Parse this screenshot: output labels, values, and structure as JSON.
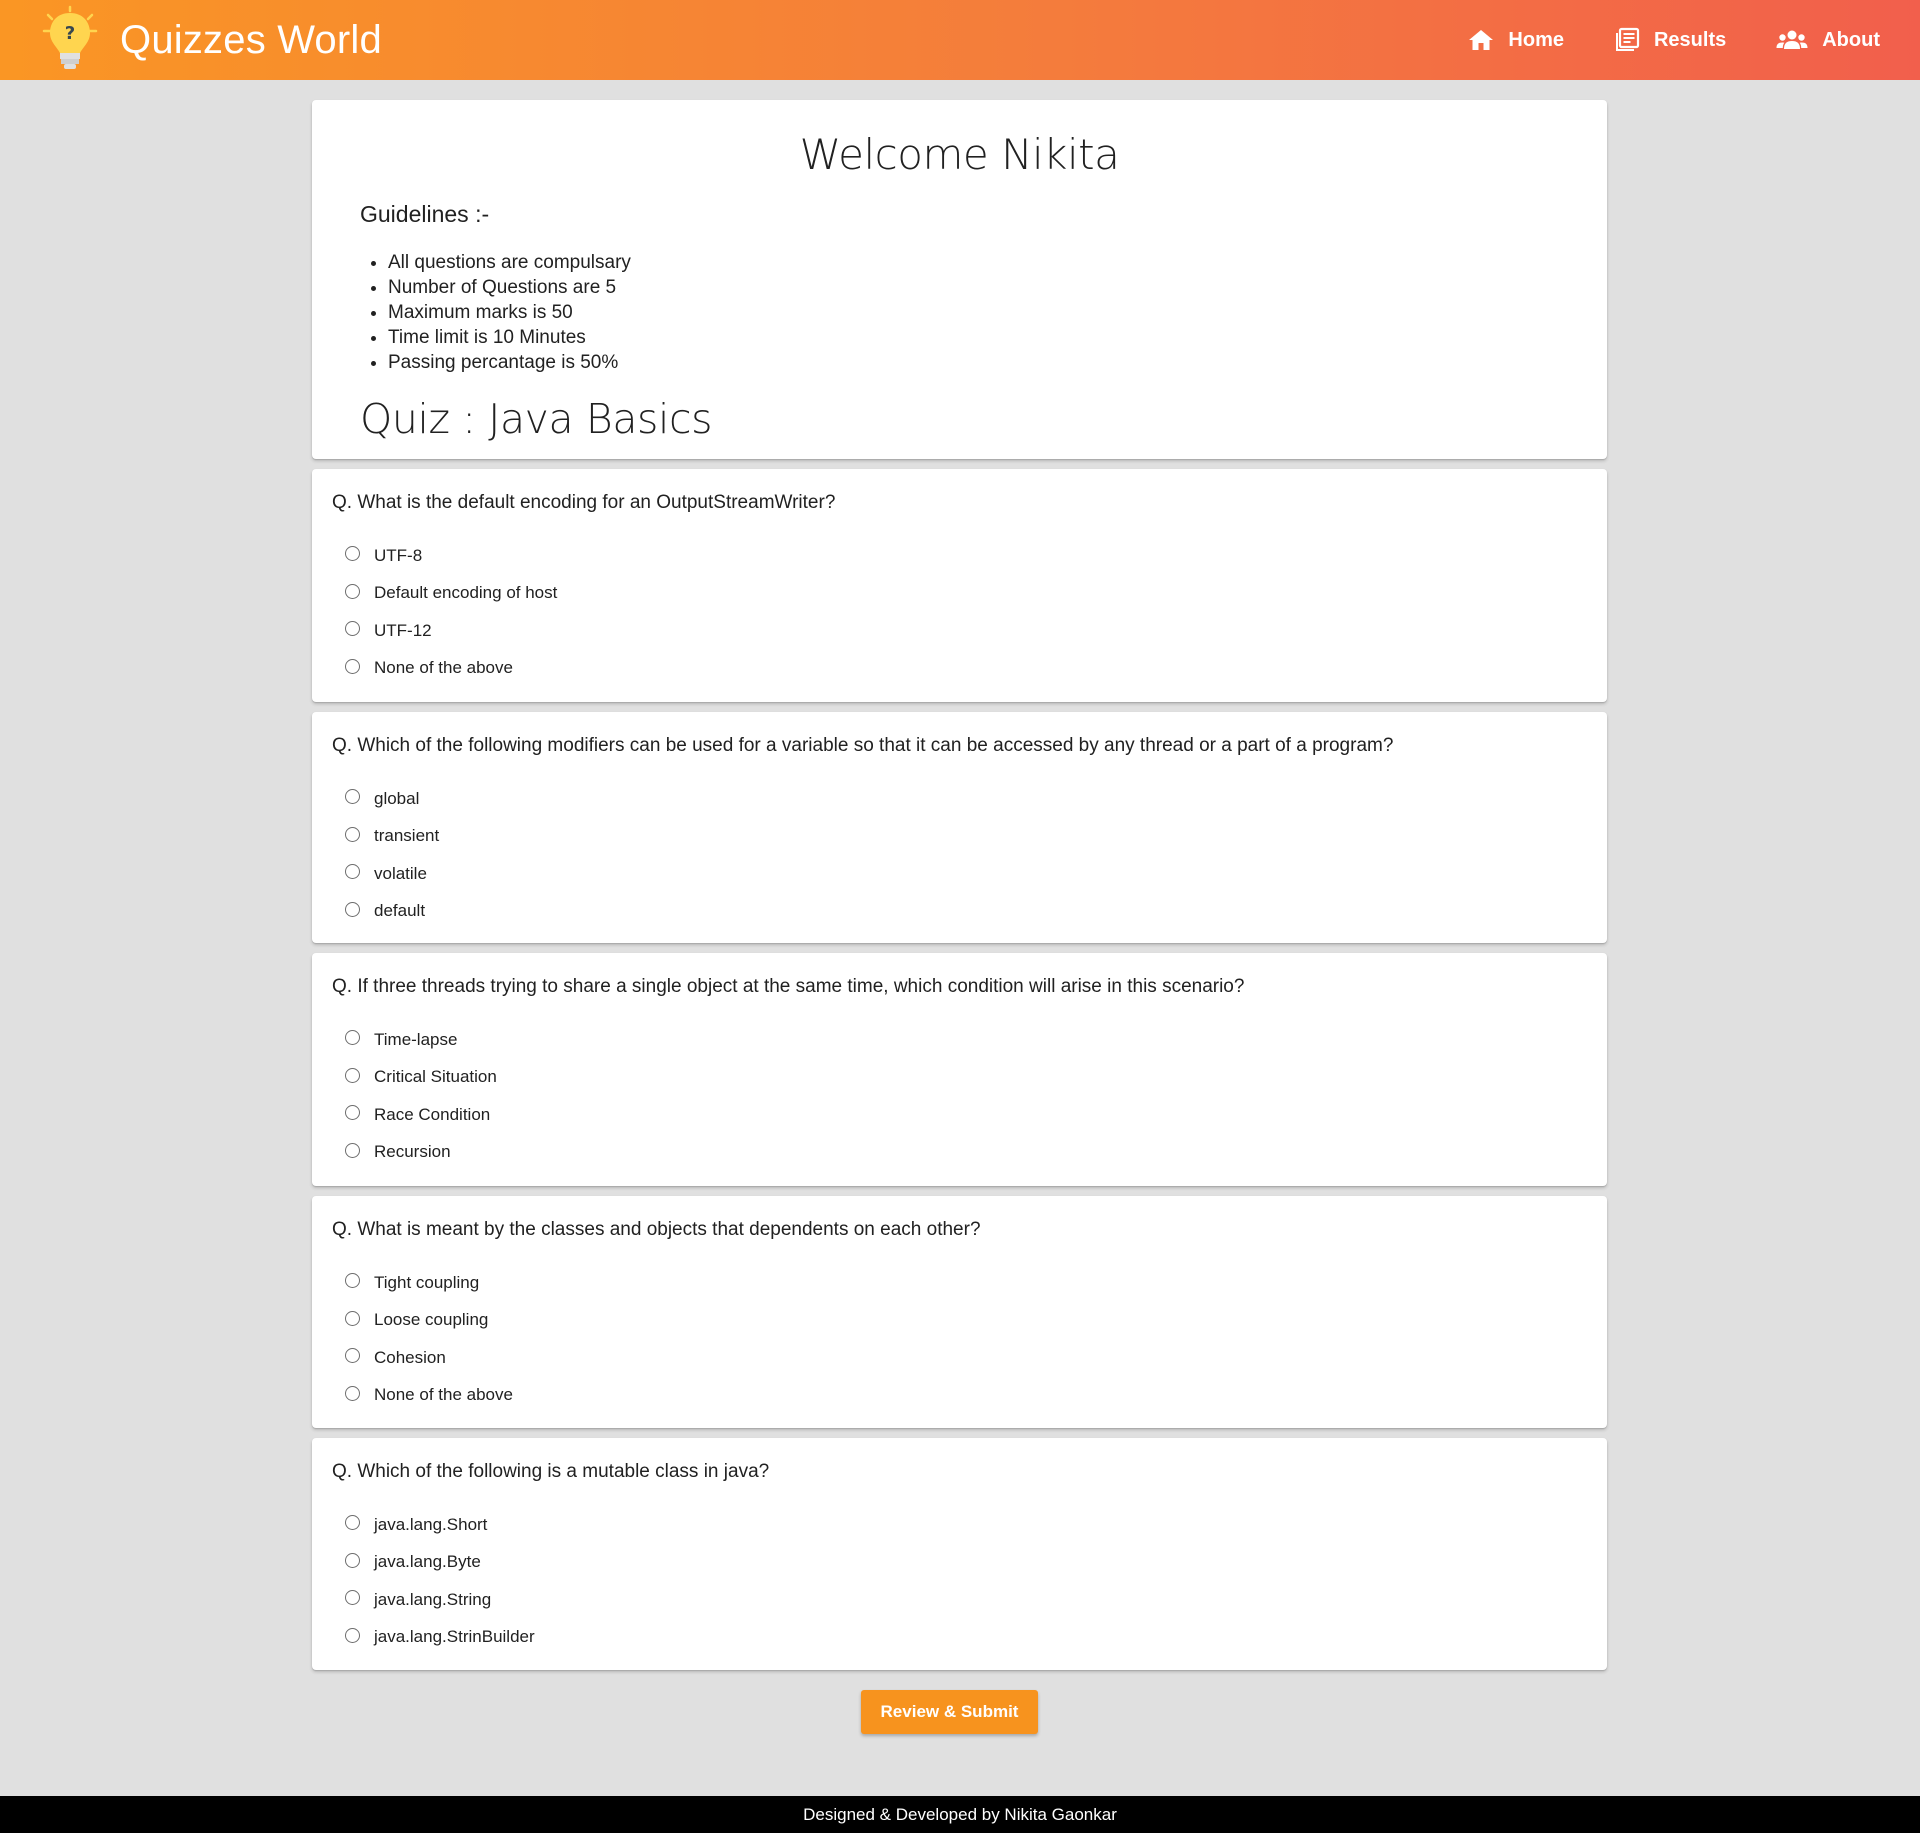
{
  "header": {
    "brand_title": "Quizzes World",
    "nav": [
      {
        "label": "Home",
        "icon": "home-icon"
      },
      {
        "label": "Results",
        "icon": "results-icon"
      },
      {
        "label": "About",
        "icon": "people-icon"
      }
    ],
    "gradient_colors": [
      "#fa9624",
      "#f25f4c"
    ]
  },
  "welcome": {
    "title": "Welcome Nikita",
    "guidelines_heading": "Guidelines :-",
    "guidelines": [
      "All questions are compulsary",
      "Number of Questions are 5",
      "Maximum marks is 50",
      "Time limit is 10 Minutes",
      "Passing percantage is 50%"
    ],
    "quiz_title": "Quiz : Java Basics"
  },
  "questions": [
    {
      "text": "Q. What is the default encoding for an OutputStreamWriter?",
      "options": [
        "UTF-8",
        "Default encoding of host",
        "UTF-12",
        "None of the above"
      ]
    },
    {
      "text": "Q. Which of the following modifiers can be used for a variable so that it can be accessed by any thread or a part of a program?",
      "options": [
        "global",
        "transient",
        "volatile",
        "default"
      ]
    },
    {
      "text": "Q. If three threads trying to share a single object at the same time, which condition will arise in this scenario?",
      "options": [
        "Time-lapse",
        "Critical Situation",
        "Race Condition",
        "Recursion"
      ]
    },
    {
      "text": "Q. What is meant by the classes and objects that dependents on each other?",
      "options": [
        "Tight coupling",
        "Loose coupling",
        "Cohesion",
        "None of the above"
      ]
    },
    {
      "text": "Q. Which of the following is a mutable class in java?",
      "options": [
        "java.lang.Short",
        "java.lang.Byte",
        "java.lang.String",
        "java.lang.StrinBuilder"
      ]
    }
  ],
  "submit_label": "Review & Submit",
  "footer_text": "Designed & Developed by Nikita Gaonkar",
  "accent_color": "#f7931e"
}
